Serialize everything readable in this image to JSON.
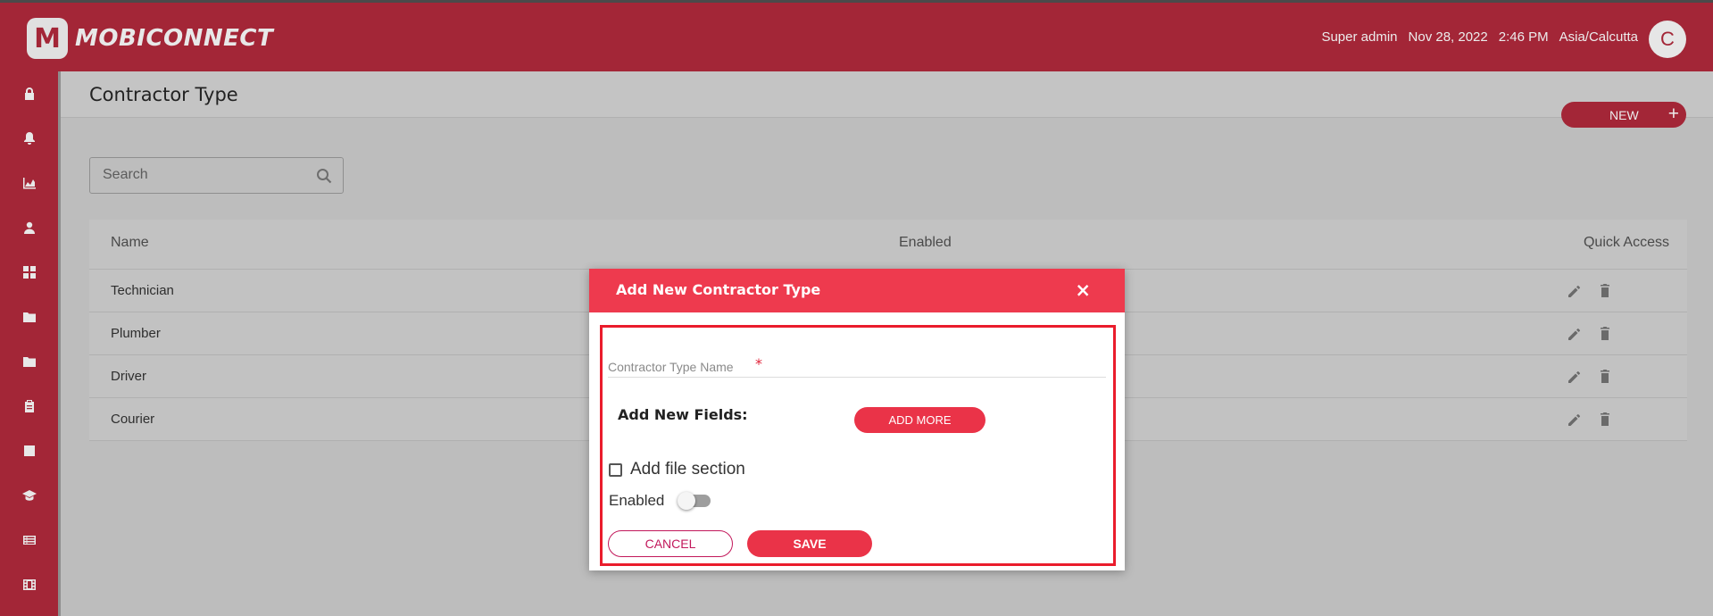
{
  "app": {
    "logo_letter": "M",
    "logo_text": "MOBICONNECT",
    "user": "Super admin",
    "date": "Nov 28, 2022",
    "time": "2:46 PM",
    "timezone": "Asia/Calcutta",
    "avatar_initial": "C"
  },
  "sidebar": {
    "items": [
      {
        "icon": "lock-icon"
      },
      {
        "icon": "bell-icon"
      },
      {
        "icon": "chart-icon"
      },
      {
        "icon": "user-icon"
      },
      {
        "icon": "grid-icon"
      },
      {
        "icon": "folder-icon"
      },
      {
        "icon": "folder-icon"
      },
      {
        "icon": "clipboard-icon"
      },
      {
        "icon": "square-icon"
      },
      {
        "icon": "graduation-cap-icon"
      },
      {
        "icon": "list-icon"
      },
      {
        "icon": "film-icon"
      }
    ]
  },
  "page": {
    "title": "Contractor Type",
    "new_button": "NEW",
    "new_plus": "+",
    "search_placeholder": "Search"
  },
  "table": {
    "headers": {
      "name": "Name",
      "enabled": "Enabled",
      "quick_access": "Quick Access"
    },
    "rows": [
      {
        "name": "Technician"
      },
      {
        "name": "Plumber"
      },
      {
        "name": "Driver"
      },
      {
        "name": "Courier"
      }
    ]
  },
  "modal": {
    "title": "Add New Contractor Type",
    "close": "×",
    "field_label": "Contractor Type Name",
    "field_required": "*",
    "add_fields_label": "Add New Fields:",
    "add_more": "ADD MORE",
    "file_section_label": "Add file section",
    "enabled_label": "Enabled",
    "cancel": "CANCEL",
    "save": "SAVE"
  },
  "colors": {
    "brand": "#a32637",
    "modal_header": "#ee3a4e",
    "accent": "#ea3348",
    "highlight": "#ea1c2c"
  }
}
